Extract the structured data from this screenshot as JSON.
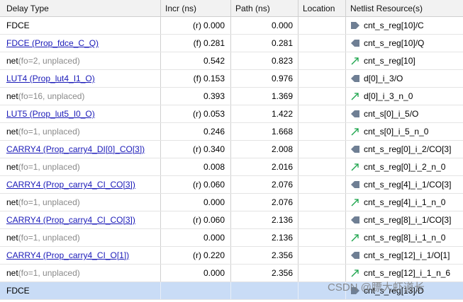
{
  "header": {
    "delay_type": "Delay Type",
    "incr": "Incr (ns)",
    "path": "Path (ns)",
    "location": "Location",
    "netlist": "Netlist Resource(s)"
  },
  "rows": [
    {
      "type": "FDCE",
      "link": false,
      "fanout": "",
      "edge": "(r)",
      "incr": "0.000",
      "path": "0.000",
      "location": "",
      "resource": "cnt_s_reg[10]/C",
      "icon": "pin-in-icon"
    },
    {
      "type": "FDCE (Prop_fdce_C_Q)",
      "link": true,
      "fanout": "",
      "edge": "(f)",
      "incr": "0.281",
      "path": "0.281",
      "location": "",
      "resource": "cnt_s_reg[10]/Q",
      "icon": "pin-out-icon"
    },
    {
      "type": "net",
      "link": false,
      "fanout": "(fo=2, unplaced)",
      "edge": "",
      "incr": "0.542",
      "path": "0.823",
      "location": "",
      "resource": "cnt_s_reg[10]",
      "icon": "net-arrow-icon"
    },
    {
      "type": "LUT4 (Prop_lut4_I1_O)",
      "link": true,
      "fanout": "",
      "edge": "(f)",
      "incr": "0.153",
      "path": "0.976",
      "location": "",
      "resource": "d[0]_i_3/O",
      "icon": "pin-out-icon"
    },
    {
      "type": "net",
      "link": false,
      "fanout": "(fo=16, unplaced)",
      "edge": "",
      "incr": "0.393",
      "path": "1.369",
      "location": "",
      "resource": "d[0]_i_3_n_0",
      "icon": "net-arrow-icon"
    },
    {
      "type": "LUT5 (Prop_lut5_I0_O)",
      "link": true,
      "fanout": "",
      "edge": "(r)",
      "incr": "0.053",
      "path": "1.422",
      "location": "",
      "resource": "cnt_s[0]_i_5/O",
      "icon": "pin-out-icon"
    },
    {
      "type": "net",
      "link": false,
      "fanout": "(fo=1, unplaced)",
      "edge": "",
      "incr": "0.246",
      "path": "1.668",
      "location": "",
      "resource": "cnt_s[0]_i_5_n_0",
      "icon": "net-arrow-icon"
    },
    {
      "type": "CARRY4 (Prop_carry4_DI[0]_CO[3])",
      "link": true,
      "fanout": "",
      "edge": "(r)",
      "incr": "0.340",
      "path": "2.008",
      "location": "",
      "resource": "cnt_s_reg[0]_i_2/CO[3]",
      "icon": "pin-out-icon"
    },
    {
      "type": "net",
      "link": false,
      "fanout": "(fo=1, unplaced)",
      "edge": "",
      "incr": "0.008",
      "path": "2.016",
      "location": "",
      "resource": "cnt_s_reg[0]_i_2_n_0",
      "icon": "net-arrow-icon"
    },
    {
      "type": "CARRY4 (Prop_carry4_CI_CO[3])",
      "link": true,
      "fanout": "",
      "edge": "(r)",
      "incr": "0.060",
      "path": "2.076",
      "location": "",
      "resource": "cnt_s_reg[4]_i_1/CO[3]",
      "icon": "pin-out-icon"
    },
    {
      "type": "net",
      "link": false,
      "fanout": "(fo=1, unplaced)",
      "edge": "",
      "incr": "0.000",
      "path": "2.076",
      "location": "",
      "resource": "cnt_s_reg[4]_i_1_n_0",
      "icon": "net-arrow-icon"
    },
    {
      "type": "CARRY4 (Prop_carry4_CI_CO[3])",
      "link": true,
      "fanout": "",
      "edge": "(r)",
      "incr": "0.060",
      "path": "2.136",
      "location": "",
      "resource": "cnt_s_reg[8]_i_1/CO[3]",
      "icon": "pin-out-icon"
    },
    {
      "type": "net",
      "link": false,
      "fanout": "(fo=1, unplaced)",
      "edge": "",
      "incr": "0.000",
      "path": "2.136",
      "location": "",
      "resource": "cnt_s_reg[8]_i_1_n_0",
      "icon": "net-arrow-icon"
    },
    {
      "type": "CARRY4 (Prop_carry4_CI_O[1])",
      "link": true,
      "fanout": "",
      "edge": "(r)",
      "incr": "0.220",
      "path": "2.356",
      "location": "",
      "resource": "cnt_s_reg[12]_i_1/O[1]",
      "icon": "pin-out-icon"
    },
    {
      "type": "net",
      "link": false,
      "fanout": "(fo=1, unplaced)",
      "edge": "",
      "incr": "0.000",
      "path": "2.356",
      "location": "",
      "resource": "cnt_s_reg[12]_i_1_n_6",
      "icon": "net-arrow-icon"
    },
    {
      "type": "FDCE",
      "link": false,
      "fanout": "",
      "edge": "",
      "incr": "",
      "path": "",
      "location": "",
      "resource": "cnt_s_reg[13]/D",
      "icon": "pin-in-icon",
      "selected": true
    }
  ],
  "watermark": "CSDN @膘大虾道长",
  "colors": {
    "link": "#1a1ab8",
    "selected_row": "#c9dcf6",
    "pin_icon": "#6f7f94",
    "net_icon": "#1aa34a"
  }
}
